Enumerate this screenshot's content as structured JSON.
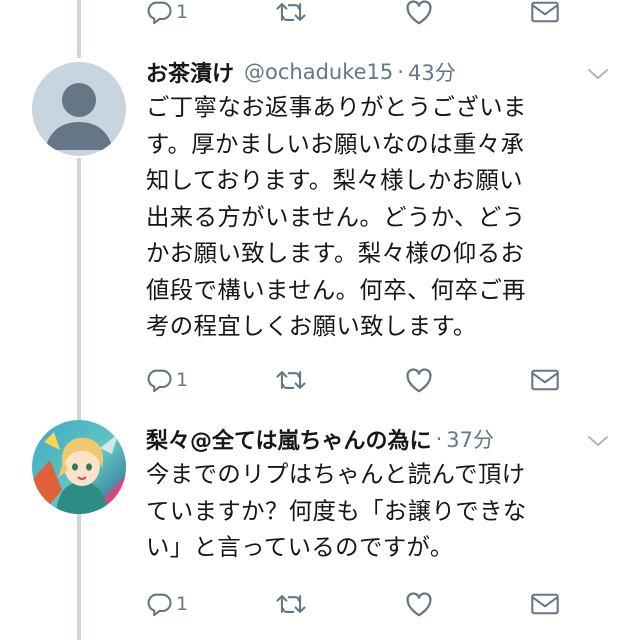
{
  "tweets": [
    {
      "text_lines": [],
      "actions": {
        "reply_count": "1"
      }
    },
    {
      "display_name": "お茶漬け",
      "handle": "@ochaduke15",
      "separator": "·",
      "time": "43分",
      "avatar": "default-avatar",
      "text_lines": [
        "ご丁寧なお返事ありがとうございま",
        "す。厚かましいお願いなのは重々承",
        "知しております。梨々様しかお願い",
        "出来る方がいません。どうか、どう",
        "かお願い致します。梨々様の仰るお",
        "値段で構いません。何卒、何卒ご再",
        "考の程宜しくお願い致します。"
      ],
      "actions": {
        "reply_count": "1"
      }
    },
    {
      "display_name": "梨々@全ては嵐ちゃんの為に",
      "separator": "·",
      "time": "37分",
      "avatar": "anime-character-avatar",
      "text_lines": [
        "今までのリプはちゃんと読んで頂け",
        "ていますか？何度も「お譲りできな",
        "い」と言っているのですが。"
      ],
      "actions": {
        "reply_count": "1"
      }
    }
  ],
  "icons": [
    "reply-icon",
    "retweet-icon",
    "like-icon",
    "dm-icon",
    "caret-down-icon"
  ],
  "colors": {
    "text": "#14171a",
    "secondary": "#657786",
    "thread_line": "#ccd6dd",
    "caret": "#aab8c2",
    "default_avatar_bg": "#c9d5de",
    "default_avatar_fg": "#657786"
  }
}
